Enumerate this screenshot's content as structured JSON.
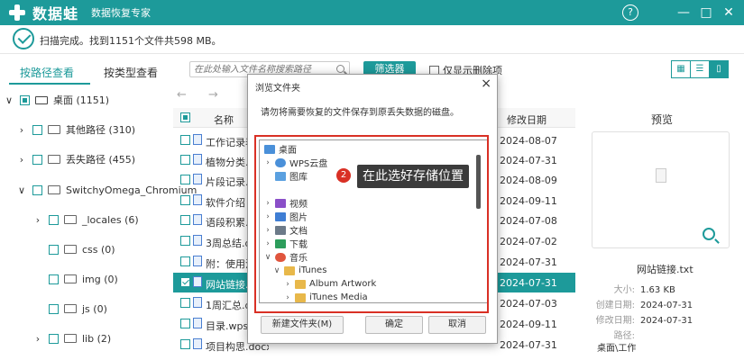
{
  "app": {
    "name": "数据蛙",
    "subtitle": "数据恢复专家",
    "help_icon": "?"
  },
  "status": {
    "text": "扫描完成。找到1151个文件共598 MB。"
  },
  "left_tabs": [
    {
      "label": "按路径查看",
      "active": true
    },
    {
      "label": "按类型查看",
      "active": false
    }
  ],
  "tree": [
    {
      "label": "桌面 (1151)",
      "expanded": true
    },
    {
      "label": "其他路径 (310)"
    },
    {
      "label": "丢失路径 (455)"
    },
    {
      "label": "SwitchyOmega_Chromium"
    },
    {
      "label": "_locales (6)"
    },
    {
      "label": "css (0)"
    },
    {
      "label": "img (0)"
    },
    {
      "label": "js (0)"
    },
    {
      "label": "lib (2)"
    }
  ],
  "toolbar": {
    "search_placeholder": "在此处输入文件名称搜索路径",
    "filter_label": "筛选器",
    "deleted_only_label": "仅显示删除项"
  },
  "file_list": {
    "nav_back": "←",
    "nav_forward": "→",
    "col_name": "名称",
    "col_date": "修改日期",
    "rows": [
      {
        "name": "工作记录表",
        "date": "2024-08-07"
      },
      {
        "name": "植物分类.d",
        "date": "2024-07-31"
      },
      {
        "name": "片段记录.w",
        "date": "2024-08-09"
      },
      {
        "name": "软件介绍 -",
        "date": "2024-09-11"
      },
      {
        "name": "语段积累.d",
        "date": "2024-07-08"
      },
      {
        "name": "3周总结.do",
        "date": "2024-07-02"
      },
      {
        "name": "附：使用注",
        "date": "2024-07-31"
      },
      {
        "name": "网站链接.t",
        "date": "2024-07-31",
        "selected": true
      },
      {
        "name": "1周汇总.do",
        "date": "2024-07-03"
      },
      {
        "name": "目录.wps",
        "date": "2024-09-11"
      },
      {
        "name": "项目构思.docx",
        "date": "2024-07-31"
      }
    ]
  },
  "preview": {
    "title": "预览",
    "file_name": "网站链接.txt",
    "meta": [
      {
        "label": "大小:",
        "value": "1.63 KB"
      },
      {
        "label": "创建日期:",
        "value": "2024-07-31"
      },
      {
        "label": "修改日期:",
        "value": "2024-07-31"
      },
      {
        "label": "路径:",
        "value": ""
      },
      {
        "label": "",
        "value": "桌面\\工作"
      }
    ]
  },
  "dialog": {
    "title": "浏览文件夹",
    "close": "×",
    "message": "请勿将需要恢复的文件保存到原丢失数据的磁盘。",
    "tree": [
      {
        "label": "桌面",
        "color": "#4a90d9"
      },
      {
        "label": "WPS云盘",
        "color": "#4a90d9"
      },
      {
        "label": "图库",
        "color": "#5aa0e0"
      },
      {
        "label": "视频",
        "color": "#8a4fc8"
      },
      {
        "label": "图片",
        "color": "#3f7ed4"
      },
      {
        "label": "文档",
        "color": "#6c7a89"
      },
      {
        "label": "下载",
        "color": "#2d9d5c"
      },
      {
        "label": "音乐",
        "color": "#e0553d"
      },
      {
        "label": "iTunes",
        "color": "#e8b84a"
      },
      {
        "label": "Album Artwork",
        "color": "#e8b84a"
      },
      {
        "label": "iTunes Media",
        "color": "#e8b84a"
      }
    ],
    "buttons": {
      "new_folder": "新建文件夹(M)",
      "ok": "确定",
      "cancel": "取消"
    }
  },
  "callout": {
    "badge": "2",
    "text": "在此选好存储位置"
  },
  "colors": {
    "accent": "#1d9a9a",
    "highlight": "#d93025"
  }
}
